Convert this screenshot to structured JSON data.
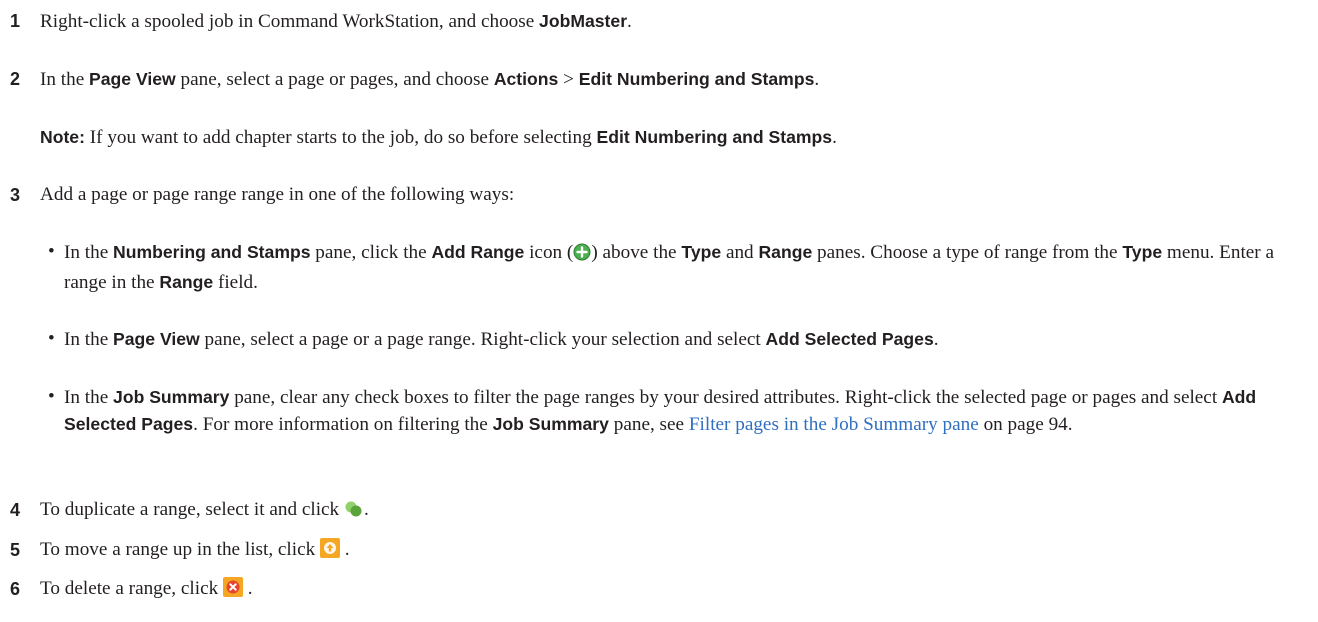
{
  "steps": [
    {
      "num": "1",
      "a": "Right-click a spooled job in Command WorkStation, and choose ",
      "b1": "JobMaster",
      "c": "."
    },
    {
      "num": "2",
      "a": "In the ",
      "b1": "Page View",
      "c": " pane, select a page or pages, and choose ",
      "b2": "Actions",
      "d": " > ",
      "b3": "Edit Numbering and Stamps",
      "e": "."
    },
    {
      "num": "3",
      "a": "Add a page or page range range in one of the following ways:"
    },
    {
      "num": "4",
      "a": "To duplicate a range, select it and click ",
      "c": "."
    },
    {
      "num": "5",
      "a": "To move a range up in the list, click ",
      "c": " ."
    },
    {
      "num": "6",
      "a": "To delete a range, click ",
      "c": " ."
    }
  ],
  "note": {
    "label": "Note:",
    "a": " If you want to add chapter starts to the job, do so before selecting ",
    "b1": "Edit Numbering and Stamps",
    "c": "."
  },
  "bullets": [
    {
      "t1": "In the ",
      "b1": "Numbering and Stamps",
      "t2": " pane, click the ",
      "b2": "Add Range",
      "t3": " icon (",
      "t4": ") above the ",
      "b3": "Type",
      "t5": " and ",
      "b4": "Range",
      "t6": " panes. Choose a type of range from the ",
      "b5": "Type",
      "t7": " menu. Enter a range in the ",
      "b6": "Range",
      "t8": " field."
    },
    {
      "t1": "In the ",
      "b1": "Page View",
      "t2": " pane, select a page or a page range. Right-click your selection and select ",
      "b2": "Add Selected Pages",
      "t3": "."
    },
    {
      "t1": "In the ",
      "b1": "Job Summary",
      "t2": " pane, clear any check boxes to filter the page ranges by your desired attributes. Right-click the selected page or pages and select ",
      "b2": "Add Selected Pages",
      "t3": ". For more information on filtering the ",
      "b3": "Job Summary",
      "t4": " pane, see ",
      "link": "Filter pages in the Job Summary pane",
      "t5": " on page 94."
    }
  ],
  "bullet_char": "•",
  "icons": {
    "add_range": {
      "name": "add-range-icon",
      "color": "#4caf50"
    },
    "duplicate": {
      "name": "duplicate-icon",
      "color": "#6cbf4a"
    },
    "move_up": {
      "name": "move-up-icon",
      "color": "#f5a623"
    },
    "delete": {
      "name": "delete-icon",
      "color": "#e8452c"
    }
  }
}
